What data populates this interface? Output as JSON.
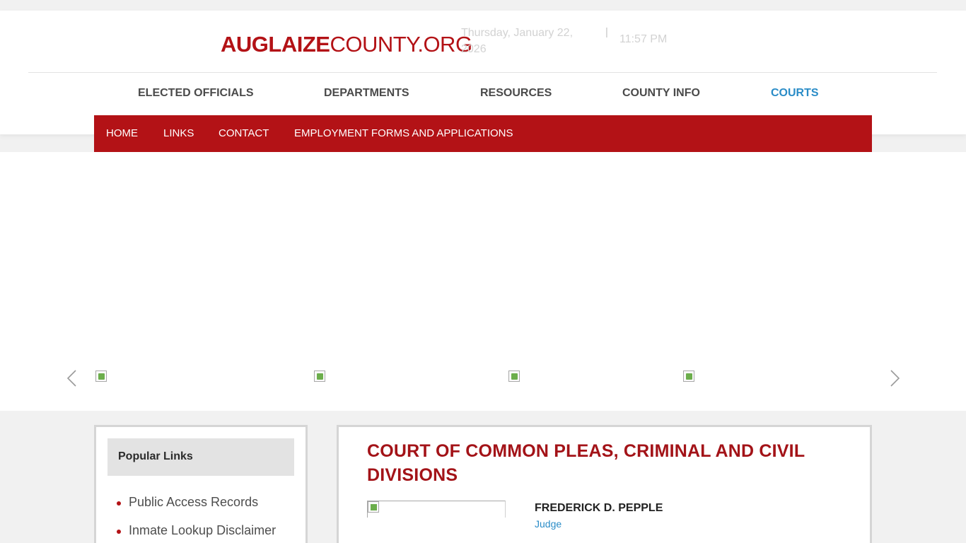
{
  "site": {
    "logo_bold": "AUGLAIZE",
    "logo_light": "COUNTY.ORG",
    "date": "Thursday, January 22, 2026",
    "separator": "|",
    "time": "11:57 PM"
  },
  "main_nav": {
    "items": [
      "ELECTED OFFICIALS",
      "DEPARTMENTS",
      "RESOURCES",
      "COUNTY INFO",
      "COURTS"
    ],
    "active": "COURTS",
    "active_color": "#2a8cc7"
  },
  "sub_nav": {
    "items": [
      "HOME",
      "LINKS",
      "CONTACT",
      "EMPLOYMENT FORMS AND APPLICATIONS"
    ],
    "bg_color": "#b31216"
  },
  "carousel": {
    "prev_icon": "chevron-left-icon",
    "next_icon": "chevron-right-icon",
    "thumbnail_icon": "broken-image-icon"
  },
  "sidebar": {
    "heading": "Popular Links",
    "links": [
      "Public Access Records",
      "Inmate Lookup Disclaimer"
    ]
  },
  "content": {
    "title": "COURT OF COMMON PLEAS, CRIMINAL AND CIVIL DIVISIONS",
    "person_name": "FREDERICK D. PEPPLE",
    "person_role": "Judge",
    "title_color": "#a31318"
  }
}
